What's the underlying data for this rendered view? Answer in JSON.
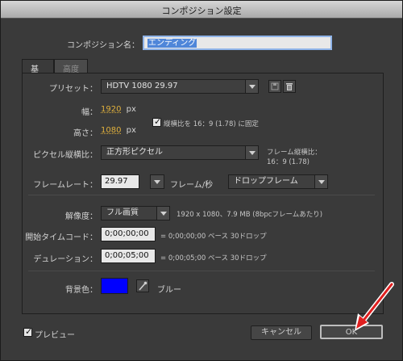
{
  "window": {
    "title": "コンポジション設定"
  },
  "composition_name": {
    "label": "コンポジション名：",
    "value": "エンディング"
  },
  "tabs": [
    {
      "label": "基本"
    },
    {
      "label": "高度"
    }
  ],
  "preset": {
    "label": "プリセット：",
    "value": "HDTV 1080 29.97",
    "save_icon": "save-preset-icon",
    "delete_icon": "trash-icon"
  },
  "width": {
    "label": "幅：",
    "value": "1920",
    "unit": "px"
  },
  "height": {
    "label": "高さ：",
    "value": "1080",
    "unit": "px"
  },
  "aspect_lock": {
    "label": "縦横比を 16：9 (1.78) に固定",
    "checked": true
  },
  "pixel_aspect": {
    "label": "ピクセル縦横比：",
    "value": "正方形ピクセル",
    "frame_aspect_label": "フレーム縦横比：",
    "frame_aspect_value": "16：9 (1.78)"
  },
  "frame_rate": {
    "label": "フレームレート：",
    "value": "29.97",
    "unit": "フレーム/秒",
    "drop_value": "ドロップフレーム"
  },
  "resolution": {
    "label": "解像度：",
    "value": "フル画質",
    "info": "1920 x 1080、7.9 MB (8bpcフレームあたり)"
  },
  "start_timecode": {
    "label": "開始タイムコード：",
    "value": "0;00;00;00",
    "info": "= 0;00;00;00  ベース 30ドロップ"
  },
  "duration": {
    "label": "デュレーション：",
    "value": "0;00;05;00",
    "info": "= 0;00;05;00  ベース 30ドロップ"
  },
  "background": {
    "label": "背景色：",
    "color": "#0000ff",
    "color_name": "ブルー",
    "eyedropper_icon": "eyedropper-icon"
  },
  "footer": {
    "preview_label": "プレビュー",
    "preview_checked": true,
    "cancel_label": "キャンセル",
    "ok_label": "OK"
  },
  "annotation": {
    "icon": "red-pointer-arrow",
    "color": "#e02020"
  }
}
